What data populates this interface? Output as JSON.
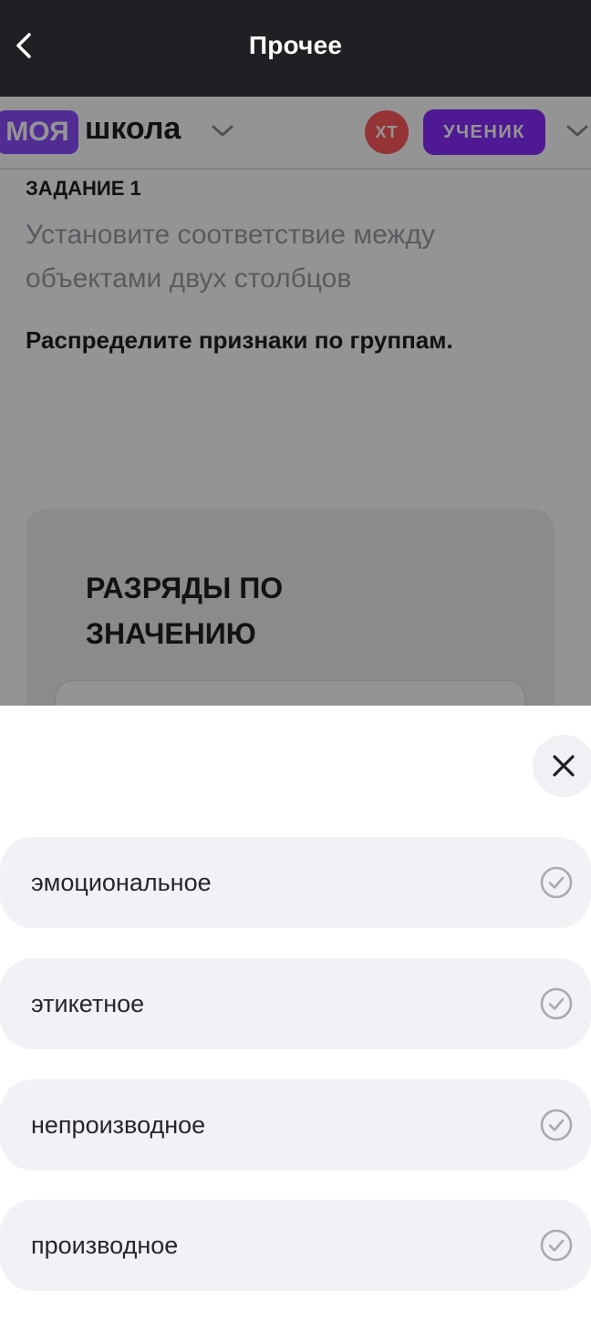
{
  "appbar": {
    "title": "Прочее"
  },
  "site_header": {
    "logo_part1": "МОЯ",
    "logo_part2": "школа",
    "avatar_initials": "ХТ",
    "role": "УЧЕНИК"
  },
  "task": {
    "label": "ЗАДАНИЕ 1",
    "description": "Установите соответствие между объектами двух столбцов",
    "instruction": "Распределите признаки по группам."
  },
  "group": {
    "title": "РАЗРЯДЫ ПО ЗНАЧЕНИЮ"
  },
  "sheet": {
    "options": [
      {
        "label": "эмоциональное"
      },
      {
        "label": "этикетное"
      },
      {
        "label": "непроизводное"
      },
      {
        "label": "производное"
      }
    ]
  },
  "colors": {
    "appbar_bg": "#1f1f24",
    "brand_purple": "#8a2bff",
    "avatar_red": "#ff5a5f",
    "option_bg": "#f1f1f6"
  }
}
